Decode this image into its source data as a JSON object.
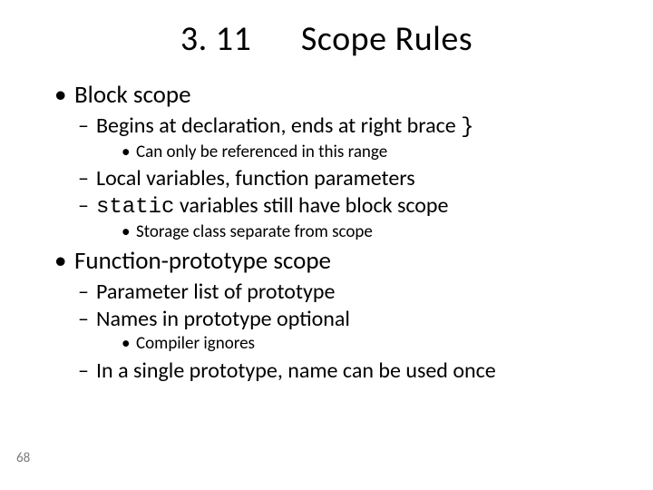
{
  "title": "3. 11      Scope Rules",
  "b1": "Block scope",
  "b1_1a": "Begins at declaration, ends at right brace ",
  "b1_1_brace": "}",
  "b1_1_1": "Can only be referenced in this range",
  "b1_2": "Local variables, function parameters",
  "b1_3_code": "static",
  "b1_3_rest": " variables still have block scope",
  "b1_3_1": "Storage class separate from scope",
  "b2": "Function-prototype scope",
  "b2_1": "Parameter list of prototype",
  "b2_2": "Names in prototype optional",
  "b2_2_1": "Compiler ignores",
  "b2_3": "In a single prototype, name can be used once",
  "pagenum": "68"
}
